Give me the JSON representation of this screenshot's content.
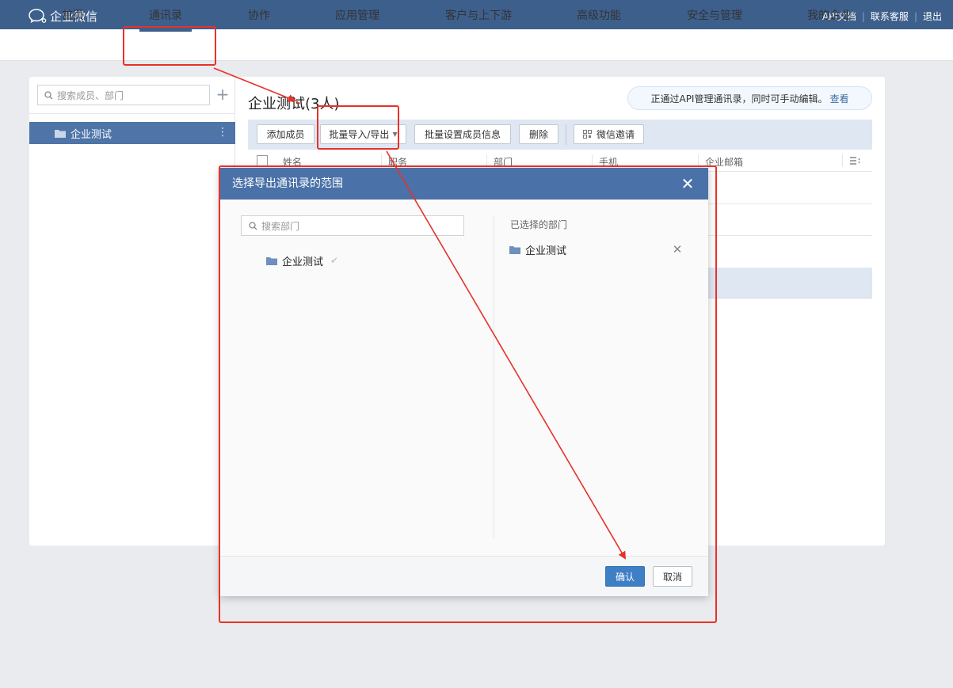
{
  "app": {
    "title": "企业微信"
  },
  "header_links": [
    "API文档",
    "联系客服",
    "退出"
  ],
  "nav": {
    "items": [
      "首页",
      "通讯录",
      "协作",
      "应用管理",
      "客户与上下游",
      "高级功能",
      "安全与管理",
      "我的企业"
    ],
    "active_index": 1
  },
  "sidebar": {
    "search_placeholder": "搜索成员、部门",
    "add_symbol": "+",
    "dept": {
      "label": "企业测试"
    }
  },
  "main": {
    "title": "企业测试(3人)",
    "api_notice": "正通过API管理通讯录，同时可手动编辑。",
    "api_notice_link": "查看",
    "toolbar": {
      "add_member": "添加成员",
      "batch_import_export": "批量导入/导出",
      "batch_set_info": "批量设置成员信息",
      "delete": "删除",
      "wechat_invite": "微信邀请"
    },
    "table": {
      "columns": [
        "姓名",
        "职务",
        "部门",
        "手机",
        "企业邮箱"
      ]
    }
  },
  "modal": {
    "title": "选择导出通讯录的范围",
    "search_placeholder": "搜索部门",
    "tree": [
      {
        "label": "企业测试"
      }
    ],
    "selected_label": "已选择的部门",
    "selected": [
      {
        "label": "企业测试"
      }
    ],
    "confirm": "确认",
    "cancel": "取消"
  },
  "colors": {
    "header_bg": "#3d5f8c",
    "modal_header_bg": "#4a72a8",
    "primary_button": "#3e7fc5",
    "annotation_red": "#e8312a"
  }
}
